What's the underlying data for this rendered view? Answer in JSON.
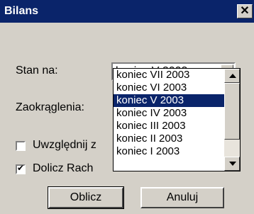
{
  "window": {
    "title": "Bilans",
    "close": "✕"
  },
  "form": {
    "stan_label": "Stan na:",
    "combo_value": "koniec V 2003",
    "zaokraglenia_label": "Zaokrąglenia:",
    "uwzglednij_label": "Uwzględnij z",
    "dolicz_label": "Dolicz Rach",
    "uwzglednij_checked": false,
    "dolicz_checked": true
  },
  "dropdown": {
    "items": [
      "koniec VII 2003",
      "koniec VI 2003",
      "koniec V 2003",
      "koniec IV 2003",
      "koniec III 2003",
      "koniec II 2003",
      "koniec I 2003"
    ],
    "selected_index": 2
  },
  "buttons": {
    "oblicz": "Oblicz",
    "anuluj": "Anuluj"
  },
  "colors": {
    "accent": "#0a246a",
    "face": "#d4d0c8"
  }
}
